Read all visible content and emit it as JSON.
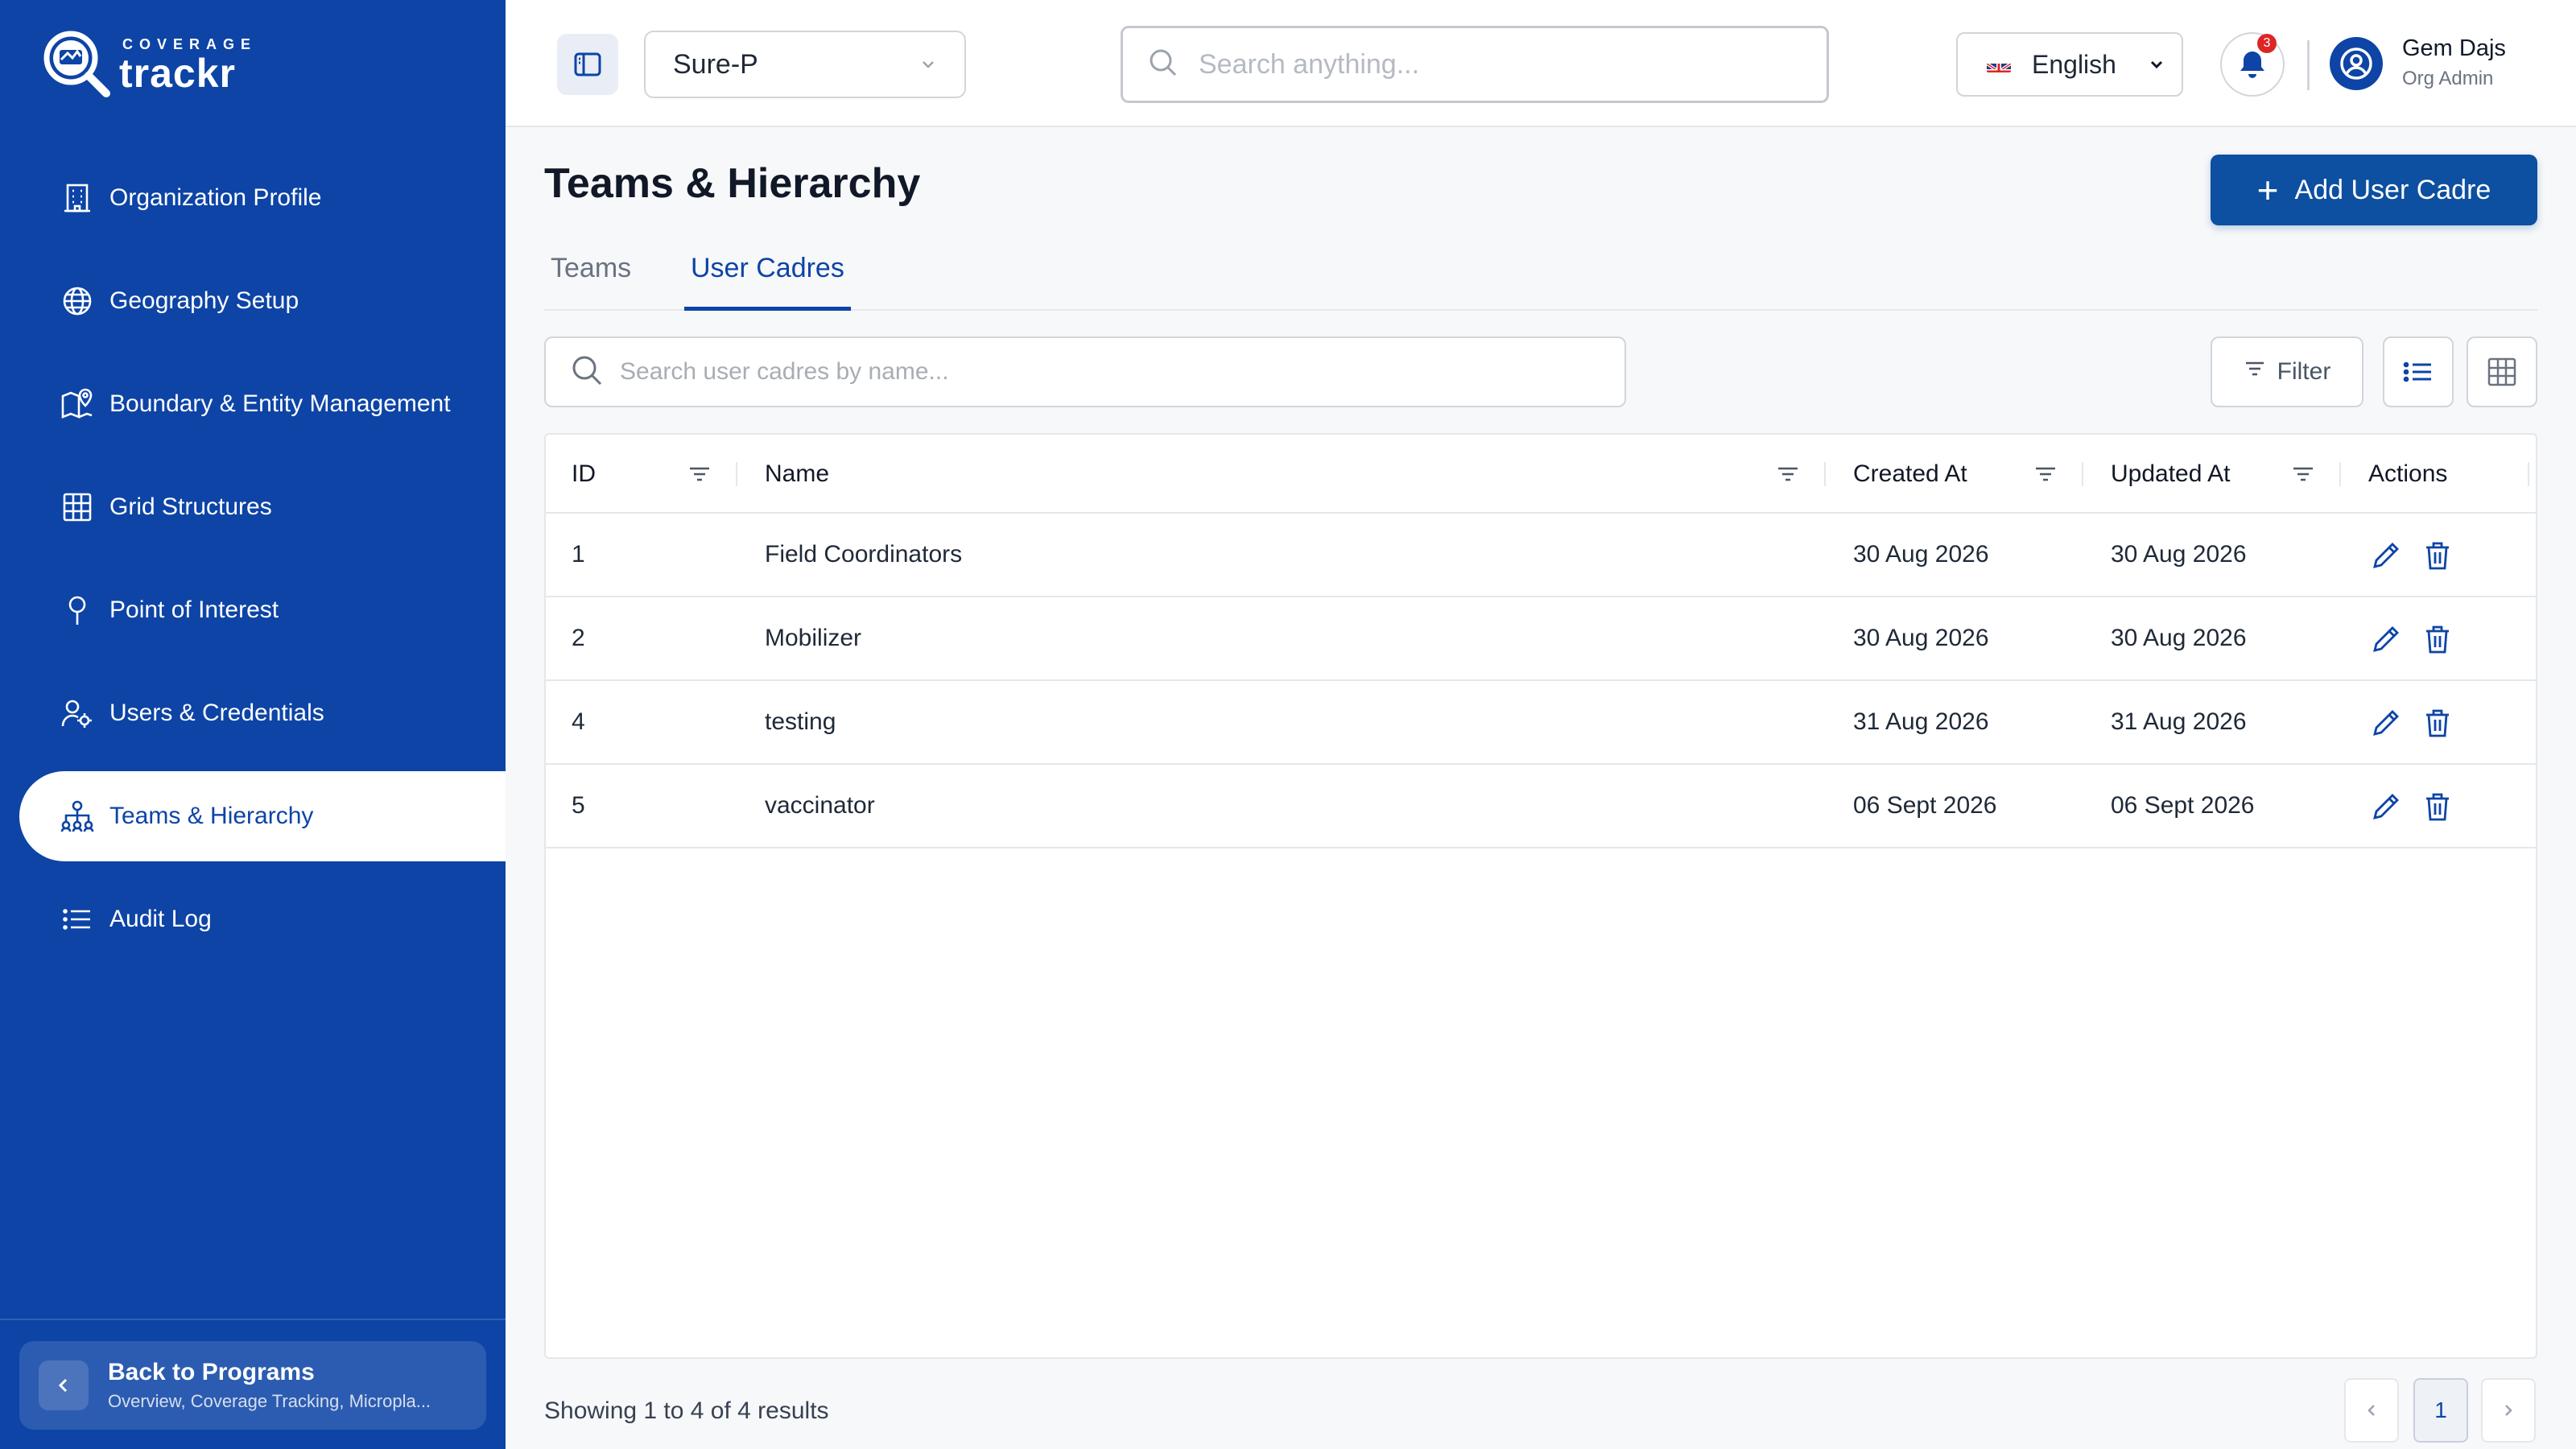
{
  "brand": {
    "top": "COVERAGE",
    "main": "trackr"
  },
  "sidebar": {
    "items": [
      {
        "label": "Organization Profile",
        "icon": "building-icon"
      },
      {
        "label": "Geography Setup",
        "icon": "globe-icon"
      },
      {
        "label": "Boundary & Entity Management",
        "icon": "map-pin-icon"
      },
      {
        "label": "Grid Structures",
        "icon": "grid-icon"
      },
      {
        "label": "Point of Interest",
        "icon": "pin-icon"
      },
      {
        "label": "Users & Credentials",
        "icon": "users-gear-icon"
      },
      {
        "label": "Teams & Hierarchy",
        "icon": "hierarchy-icon",
        "active": true
      },
      {
        "label": "Audit Log",
        "icon": "list-icon"
      }
    ],
    "back": {
      "title": "Back to Programs",
      "subtitle": "Overview, Coverage Tracking, Micropla..."
    }
  },
  "topbar": {
    "program": "Sure-P",
    "search_placeholder": "Search anything...",
    "language": "English",
    "notification_count": "3",
    "user_name": "Gem Dajs",
    "user_role": "Org Admin"
  },
  "page": {
    "title": "Teams & Hierarchy",
    "add_button": "Add User Cadre",
    "tabs": [
      "Teams",
      "User Cadres"
    ],
    "active_tab": "User Cadres",
    "search_placeholder": "Search user cadres by name...",
    "filter_label": "Filter"
  },
  "table": {
    "columns": [
      "ID",
      "Name",
      "Created At",
      "Updated At",
      "Actions"
    ],
    "rows": [
      {
        "id": "1",
        "name": "Field Coordinators",
        "created": "30 Aug 2026",
        "updated": "30 Aug 2026"
      },
      {
        "id": "2",
        "name": "Mobilizer",
        "created": "30 Aug 2026",
        "updated": "30 Aug 2026"
      },
      {
        "id": "4",
        "name": "testing",
        "created": "31 Aug 2026",
        "updated": "31 Aug 2026"
      },
      {
        "id": "5",
        "name": "vaccinator",
        "created": "06 Sept 2026",
        "updated": "06 Sept 2026"
      }
    ]
  },
  "pagination": {
    "summary": "Showing 1 to 4 of 4 results",
    "current": "1"
  },
  "colors": {
    "primary": "#0d44a6",
    "button": "#0d4fa0",
    "badge": "#dc2626"
  }
}
